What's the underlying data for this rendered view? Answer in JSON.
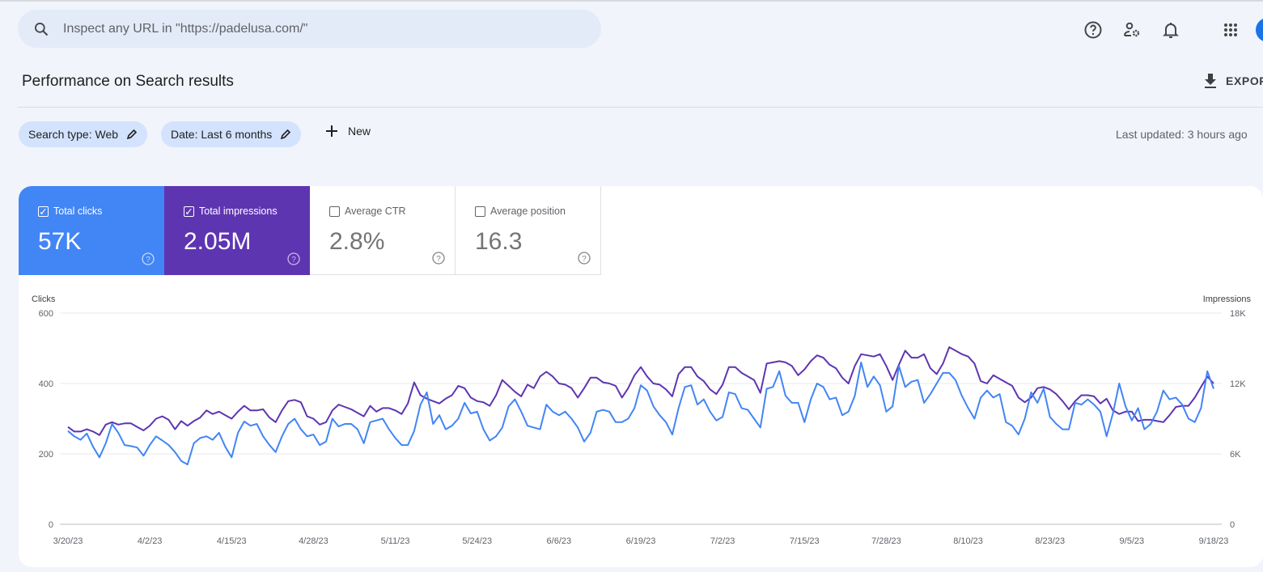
{
  "search": {
    "placeholder": "Inspect any URL in \"https://padelusa.com/\"",
    "icon": "search-icon"
  },
  "header_icons": [
    "help-icon",
    "manage-users-icon",
    "bell-icon",
    "apps-grid-icon",
    "avatar"
  ],
  "page": {
    "title": "Performance on Search results",
    "export_label": "EXPORT",
    "last_updated": "Last updated: 3 hours ago"
  },
  "filters": [
    {
      "label": "Search type: Web"
    },
    {
      "label": "Date: Last 6 months"
    }
  ],
  "new_label": "New",
  "metrics": [
    {
      "label": "Total clicks",
      "value": "57K",
      "checked": true,
      "color": "#4285f4"
    },
    {
      "label": "Total impressions",
      "value": "2.05M",
      "checked": true,
      "color": "#5e35b1"
    },
    {
      "label": "Average CTR",
      "value": "2.8%",
      "checked": false
    },
    {
      "label": "Average position",
      "value": "16.3",
      "checked": false
    }
  ],
  "chart_data": {
    "type": "line",
    "ylabel_left": "Clicks",
    "ylabel_right": "Impressions",
    "yticks_left": [
      "0",
      "200",
      "400",
      "600"
    ],
    "yticks_right": [
      "0",
      "6K",
      "12K",
      "18K"
    ],
    "ylim_left": [
      0,
      600
    ],
    "ylim_right": [
      0,
      18000
    ],
    "grid": true,
    "xticks": [
      "3/20/23",
      "4/2/23",
      "4/15/23",
      "4/28/23",
      "5/11/23",
      "5/24/23",
      "6/6/23",
      "6/19/23",
      "7/2/23",
      "7/15/23",
      "7/28/23",
      "8/10/23",
      "8/23/23",
      "9/5/23",
      "9/18/23"
    ],
    "x": [
      "3/20/23",
      "3/21/23",
      "3/22/23",
      "3/23/23",
      "3/24/23",
      "3/25/23",
      "3/26/23",
      "3/27/23",
      "3/28/23",
      "3/29/23",
      "3/30/23",
      "3/31/23",
      "4/1/23",
      "4/2/23",
      "4/3/23",
      "4/4/23",
      "4/5/23",
      "4/6/23",
      "4/7/23",
      "4/8/23",
      "4/9/23",
      "4/10/23",
      "4/11/23",
      "4/12/23",
      "4/13/23",
      "4/14/23",
      "4/15/23",
      "4/16/23",
      "4/17/23",
      "4/18/23",
      "4/19/23",
      "4/20/23",
      "4/21/23",
      "4/22/23",
      "4/23/23",
      "4/24/23",
      "4/25/23",
      "4/26/23",
      "4/27/23",
      "4/28/23",
      "4/29/23",
      "4/30/23",
      "5/1/23",
      "5/2/23",
      "5/3/23",
      "5/4/23",
      "5/5/23",
      "5/6/23",
      "5/7/23",
      "5/8/23",
      "5/9/23",
      "5/10/23",
      "5/11/23",
      "5/12/23",
      "5/13/23",
      "5/14/23",
      "5/15/23",
      "5/16/23",
      "5/17/23",
      "5/18/23",
      "5/19/23",
      "5/20/23",
      "5/21/23",
      "5/22/23",
      "5/23/23",
      "5/24/23",
      "5/25/23",
      "5/26/23",
      "5/27/23",
      "5/28/23",
      "5/29/23",
      "5/30/23",
      "5/31/23",
      "6/1/23",
      "6/2/23",
      "6/3/23",
      "6/4/23",
      "6/5/23",
      "6/6/23",
      "6/7/23",
      "6/8/23",
      "6/9/23",
      "6/10/23",
      "6/11/23",
      "6/12/23",
      "6/13/23",
      "6/14/23",
      "6/15/23",
      "6/16/23",
      "6/17/23",
      "6/18/23",
      "6/19/23",
      "6/20/23",
      "6/21/23",
      "6/22/23",
      "6/23/23",
      "6/24/23",
      "6/25/23",
      "6/26/23",
      "6/27/23",
      "6/28/23",
      "6/29/23",
      "6/30/23",
      "7/1/23",
      "7/2/23",
      "7/3/23",
      "7/4/23",
      "7/5/23",
      "7/6/23",
      "7/7/23",
      "7/8/23",
      "7/9/23",
      "7/10/23",
      "7/11/23",
      "7/12/23",
      "7/13/23",
      "7/14/23",
      "7/15/23",
      "7/16/23",
      "7/17/23",
      "7/18/23",
      "7/19/23",
      "7/20/23",
      "7/21/23",
      "7/22/23",
      "7/23/23",
      "7/24/23",
      "7/25/23",
      "7/26/23",
      "7/27/23",
      "7/28/23",
      "7/29/23",
      "7/30/23",
      "7/31/23",
      "8/1/23",
      "8/2/23",
      "8/3/23",
      "8/4/23",
      "8/5/23",
      "8/6/23",
      "8/7/23",
      "8/8/23",
      "8/9/23",
      "8/10/23",
      "8/11/23",
      "8/12/23",
      "8/13/23",
      "8/14/23",
      "8/15/23",
      "8/16/23",
      "8/17/23",
      "8/18/23",
      "8/19/23",
      "8/20/23",
      "8/21/23",
      "8/22/23",
      "8/23/23",
      "8/24/23",
      "8/25/23",
      "8/26/23",
      "8/27/23",
      "8/28/23",
      "8/29/23",
      "8/30/23",
      "8/31/23",
      "9/1/23",
      "9/2/23",
      "9/3/23",
      "9/4/23",
      "9/5/23",
      "9/6/23",
      "9/7/23",
      "9/8/23",
      "9/9/23",
      "9/10/23",
      "9/11/23",
      "9/12/23",
      "9/13/23",
      "9/14/23",
      "9/15/23",
      "9/16/23",
      "9/17/23",
      "9/18/23"
    ],
    "series": [
      {
        "name": "Clicks",
        "axis": "left",
        "color": "#4285f4",
        "values": [
          265,
          250,
          240,
          258,
          220,
          190,
          230,
          285,
          260,
          225,
          222,
          218,
          195,
          225,
          250,
          238,
          225,
          205,
          180,
          170,
          230,
          245,
          250,
          240,
          260,
          220,
          190,
          260,
          292,
          280,
          285,
          250,
          225,
          205,
          250,
          285,
          300,
          270,
          250,
          255,
          225,
          235,
          300,
          278,
          285,
          285,
          270,
          230,
          290,
          295,
          300,
          270,
          245,
          225,
          225,
          265,
          340,
          375,
          285,
          310,
          270,
          280,
          300,
          345,
          315,
          320,
          270,
          238,
          250,
          275,
          335,
          355,
          320,
          280,
          275,
          270,
          340,
          320,
          310,
          320,
          300,
          275,
          235,
          260,
          320,
          325,
          320,
          290,
          290,
          300,
          330,
          395,
          380,
          335,
          310,
          290,
          255,
          330,
          390,
          395,
          340,
          355,
          320,
          295,
          305,
          375,
          370,
          330,
          325,
          300,
          275,
          385,
          390,
          435,
          365,
          345,
          345,
          290,
          355,
          400,
          390,
          355,
          360,
          310,
          320,
          365,
          460,
          390,
          420,
          395,
          320,
          335,
          450,
          390,
          405,
          410,
          345,
          370,
          400,
          430,
          430,
          410,
          365,
          330,
          300,
          360,
          380,
          360,
          370,
          290,
          280,
          255,
          300,
          375,
          345,
          385,
          305,
          285,
          270,
          270,
          345,
          340,
          355,
          340,
          320,
          250,
          315,
          400,
          335,
          295,
          330,
          270,
          285,
          320,
          380,
          355,
          360,
          340,
          300,
          290,
          330,
          435,
          385
        ]
      },
      {
        "name": "Impressions",
        "axis": "right",
        "color": "#5e35b1",
        "values": [
          8300,
          7900,
          7900,
          8100,
          7900,
          7600,
          8500,
          8700,
          8500,
          8600,
          8600,
          8300,
          8000,
          8400,
          9000,
          9200,
          8900,
          8100,
          8800,
          8400,
          8800,
          9100,
          9700,
          9400,
          9600,
          9300,
          9000,
          9600,
          10100,
          9700,
          9700,
          9800,
          9100,
          8700,
          9700,
          10500,
          10600,
          10400,
          9200,
          9000,
          8500,
          8700,
          9700,
          10200,
          10000,
          9800,
          9500,
          9200,
          10100,
          9600,
          9900,
          9900,
          9700,
          9400,
          10300,
          12100,
          11000,
          10700,
          10500,
          10300,
          10700,
          11000,
          11800,
          11600,
          10800,
          10500,
          10400,
          10100,
          11000,
          12300,
          11800,
          11300,
          10900,
          11900,
          11600,
          12600,
          13000,
          12600,
          12000,
          11900,
          11600,
          10800,
          11600,
          12500,
          12500,
          12100,
          12000,
          11800,
          10800,
          11600,
          12700,
          13400,
          12600,
          12000,
          11900,
          11500,
          10900,
          12800,
          13400,
          13400,
          12600,
          12200,
          11500,
          11100,
          11900,
          13400,
          13400,
          12900,
          12600,
          12300,
          11200,
          13700,
          13800,
          13900,
          13800,
          13500,
          12700,
          13200,
          13900,
          14400,
          14200,
          13600,
          13300,
          12500,
          12000,
          13500,
          14500,
          14400,
          14300,
          14500,
          13500,
          12300,
          13600,
          14800,
          14200,
          14200,
          14500,
          13300,
          12800,
          13700,
          15100,
          14800,
          14500,
          14300,
          13700,
          12200,
          12000,
          12700,
          12400,
          12100,
          11800,
          10800,
          10400,
          10800,
          11600,
          11700,
          11500,
          11100,
          10500,
          9800,
          10500,
          11000,
          11000,
          10900,
          10300,
          10700,
          9700,
          9400,
          9600,
          9600,
          8800,
          8900,
          8900,
          8800,
          8700,
          9300,
          10000,
          10100,
          10100,
          10800,
          11700,
          12600,
          12000
        ]
      }
    ]
  }
}
